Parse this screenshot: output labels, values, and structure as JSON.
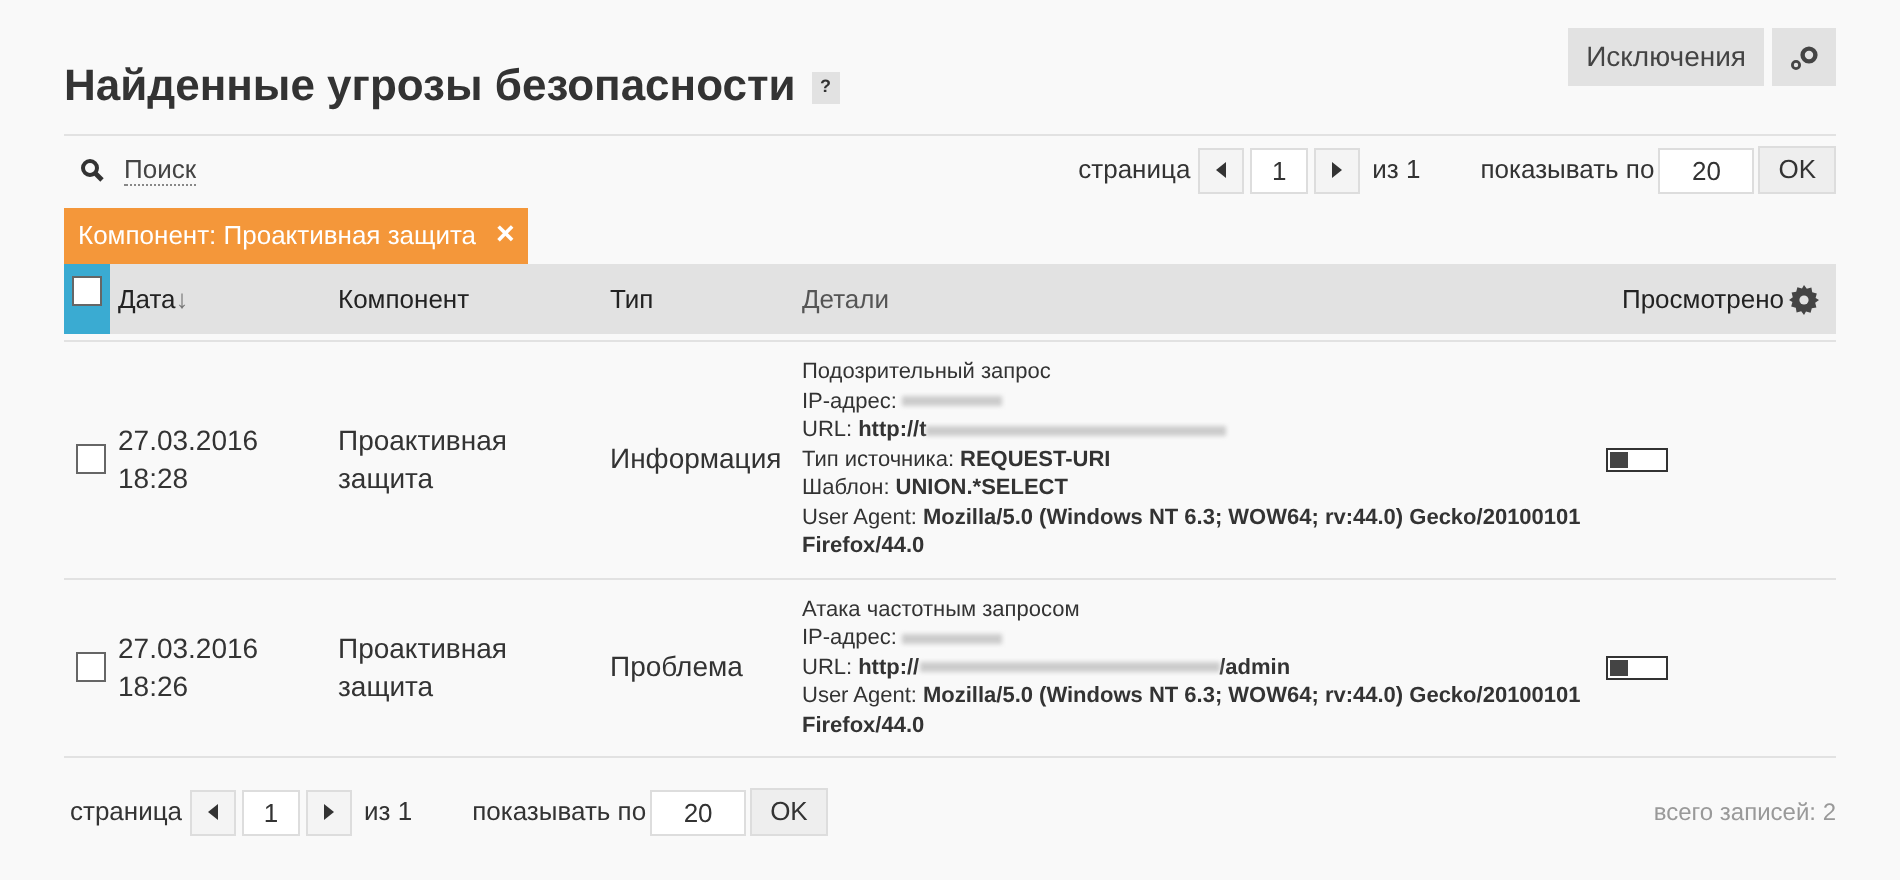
{
  "title": "Найденные угрозы безопасности",
  "help": "?",
  "header_buttons": {
    "exceptions": "Исключения"
  },
  "search": {
    "label": "Поиск"
  },
  "pager_top": {
    "page_label": "страница",
    "page": "1",
    "of": "из 1",
    "show_label": "показывать по",
    "per_page": "20",
    "ok": "OK"
  },
  "filters": [
    {
      "label": "Компонент: Проактивная защита",
      "remove": "×"
    }
  ],
  "table": {
    "select_all": {
      "checked": false
    },
    "columns": [
      {
        "label": "Дата",
        "sort": "↓"
      },
      {
        "label": "Компонент"
      },
      {
        "label": "Тип"
      },
      {
        "label": "Детали"
      },
      {
        "label": "Просмотрено"
      }
    ],
    "rows": [
      {
        "checked": false,
        "date": "27.03.2016",
        "time": "18:28",
        "component": "Проактивная защита",
        "type": "Информация",
        "viewed": false,
        "title": "Подозрительный запрос",
        "details": [
          {
            "label": "IP-адрес:",
            "redacted": true
          },
          {
            "label": "URL:",
            "value": "http://t",
            "redacted": true
          },
          {
            "label": "Тип источника:",
            "value": "REQUEST-URI",
            "redacted": false
          },
          {
            "label": "Шаблон:",
            "value": "UNION.*SELECT",
            "redacted": false
          },
          {
            "label": "User Agent:",
            "value": "Mozilla/5.0 (Windows NT 6.3; WOW64; rv:44.0) Gecko/20100101 Firefox/44.0",
            "redacted": false
          }
        ]
      },
      {
        "checked": false,
        "date": "27.03.2016",
        "time": "18:26",
        "component": "Проактивная защита",
        "type": "Проблема",
        "viewed": false,
        "title": "Атака частотным запросом",
        "details": [
          {
            "label": "IP-адрес:",
            "redacted": true
          },
          {
            "label": "URL:",
            "value": "http://",
            "redacted": true,
            "suffix": "/admin"
          },
          {
            "label": "User Agent:",
            "value": "Mozilla/5.0 (Windows NT 6.3; WOW64; rv:44.0) Gecko/20100101 Firefox/44.0",
            "redacted": false
          }
        ]
      }
    ]
  },
  "pager_bottom": {
    "page_label": "страница",
    "page": "1",
    "of": "из 1",
    "show_label": "показывать по",
    "per_page": "20",
    "ok": "OK"
  },
  "total": "всего записей: 2"
}
